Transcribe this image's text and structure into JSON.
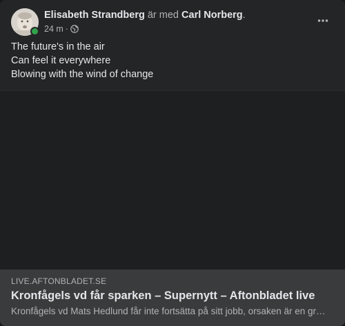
{
  "post": {
    "author": "Elisabeth Strandberg",
    "with_text": " är med ",
    "tagged": "Carl Norberg",
    "tagged_suffix": ".",
    "time": "24 m",
    "time_sep": "·",
    "privacy_icon": "globe-icon",
    "more_icon": "more-horizontal-icon",
    "lines": [
      "The future's in the air",
      "Can feel it everywhere",
      "Blowing with the wind of change"
    ]
  },
  "link": {
    "domain": "LIVE.AFTONBLADET.SE",
    "title": "Kronfågels vd får sparken – Supernytt – Aftonbladet live",
    "description": "Kronfågels vd Mats Hedlund får inte fortsätta på sitt jobb, orsaken är en granskning som visat upp missförhållanden."
  },
  "colors": {
    "card_bg": "#242526",
    "text_primary": "#e4e6eb",
    "text_secondary": "#b0b3b8",
    "online": "#31a24c",
    "link_bg": "#3a3b3c"
  }
}
